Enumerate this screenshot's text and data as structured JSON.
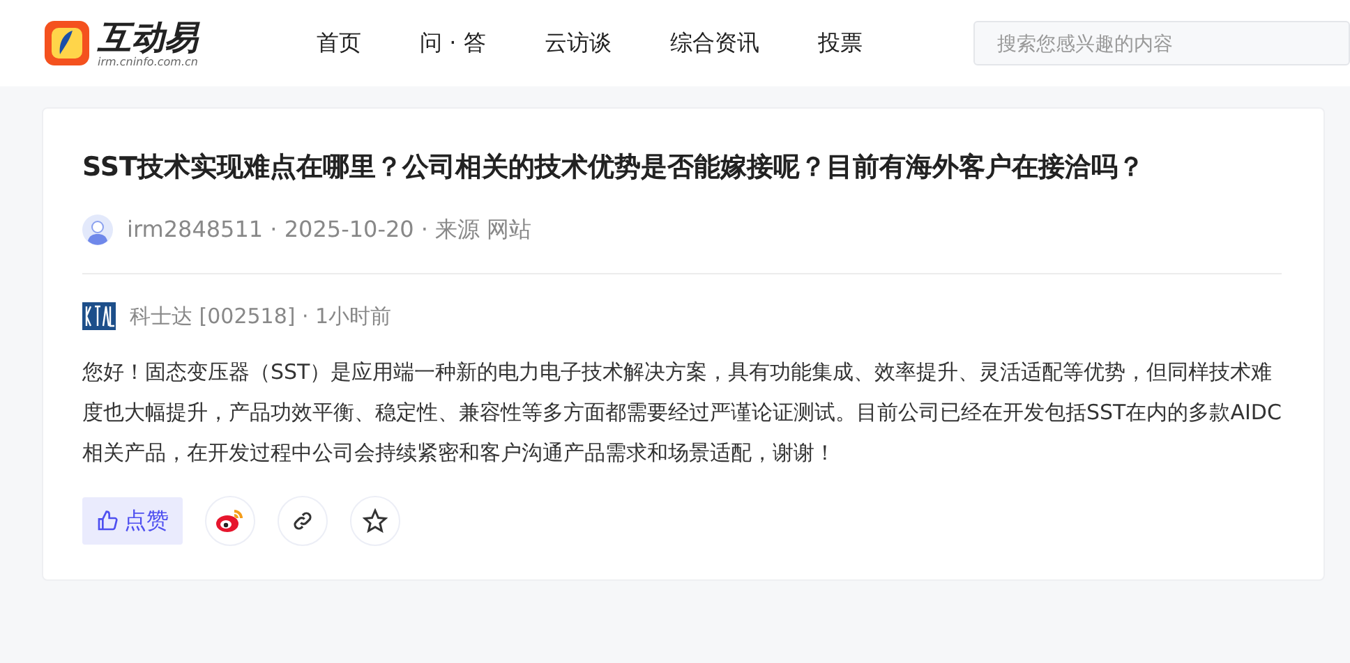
{
  "header": {
    "logo": {
      "title": "互动易",
      "subtitle": "irm.cninfo.com.cn"
    },
    "nav": [
      {
        "label": "首页"
      },
      {
        "label": "问 · 答"
      },
      {
        "label": "云访谈"
      },
      {
        "label": "综合资讯"
      },
      {
        "label": "投票"
      }
    ],
    "search": {
      "placeholder": "搜索您感兴趣的内容"
    }
  },
  "question": {
    "title": "SST技术实现难点在哪里？公司相关的技术优势是否能嫁接呢？目前有海外客户在接洽吗？",
    "meta": "irm2848511 · 2025-10-20 · 来源 网站"
  },
  "answer": {
    "company": "科士达 [002518] · 1小时前",
    "text": "您好！固态变压器（SST）是应用端一种新的电力电子技术解决方案，具有功能集成、效率提升、灵活适配等优势，但同样技术难度也大幅提升，产品功效平衡、稳定性、兼容性等多方面都需要经过严谨论证测试。目前公司已经在开发包括SST在内的多款AIDC相关产品，在开发过程中公司会持续紧密和客户沟通产品需求和场景适配，谢谢！"
  },
  "actions": [
    {
      "kind": "like",
      "label": "点赞"
    },
    {
      "kind": "weibo"
    },
    {
      "kind": "link"
    },
    {
      "kind": "star"
    }
  ]
}
